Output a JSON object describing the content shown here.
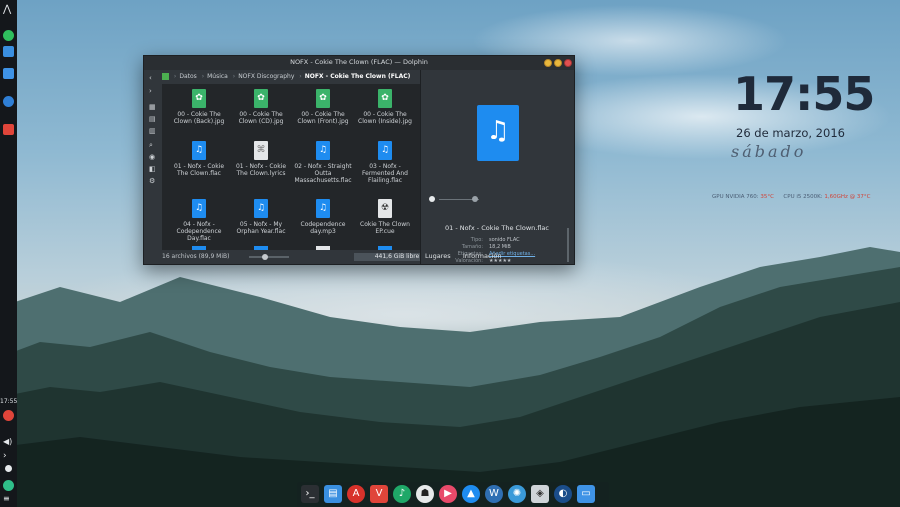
{
  "window": {
    "title": "NOFX - Cokie The Clown (FLAC) — Dolphin",
    "minimize_icon": "minimize-icon",
    "maximize_icon": "maximize-icon",
    "close_icon": "close-icon"
  },
  "breadcrumb": [
    "Datos",
    "Música",
    "NOFX Discography",
    "NOFX - Cokie The Clown (FLAC)"
  ],
  "files": [
    {
      "name": "00 - Cokie The Clown (Back).jpg",
      "type": "image"
    },
    {
      "name": "00 - Cokie The Clown (CD).jpg",
      "type": "image"
    },
    {
      "name": "00 - Cokie The Clown (Front).jpg",
      "type": "image"
    },
    {
      "name": "00 - Cokie The Clown (Inside).jpg",
      "type": "image"
    },
    {
      "name": "01 - Nofx - Cokie The Clown.flac",
      "type": "audio"
    },
    {
      "name": "01 - Nofx - Cokie The Clown.lyrics",
      "type": "text"
    },
    {
      "name": "02 - Nofx - Straight Outta Massachusetts.flac",
      "type": "audio"
    },
    {
      "name": "03 - Nofx - Fermented And Flailing.flac",
      "type": "audio"
    },
    {
      "name": "04 - Nofx - Codependence Day.flac",
      "type": "audio"
    },
    {
      "name": "05 - Nofx - My Orphan Year.flac",
      "type": "audio"
    },
    {
      "name": "Codependence day.mp3",
      "type": "audio"
    },
    {
      "name": "Cokie The Clown EP.cue",
      "type": "cue"
    }
  ],
  "status": {
    "count": "16 archivos (89,9 MiB)",
    "free": "441,6 GiB libre"
  },
  "info_panel": {
    "title": "01 - Nofx - Cokie The Clown.flac",
    "rows": [
      {
        "key": "Tipo:",
        "value": "sonido FLAC"
      },
      {
        "key": "Tamaño:",
        "value": "18,2 MiB"
      },
      {
        "key": "Etiquetas:",
        "value": "Añadir etiquetas..."
      },
      {
        "key": "Valoración:",
        "value": "★★★★★"
      }
    ],
    "tabs": [
      "Lugares",
      "Información"
    ]
  },
  "widget": {
    "time": "17:55",
    "date": "26 de marzo, 2016",
    "day": "sábado",
    "sysmon": {
      "gpu_label": "GPU NVIDIA 760:",
      "gpu_temp": "35°C",
      "cpu_label": "CPU i5 2500K:",
      "cpu_freq": "1,60GHz @ 37°C"
    }
  },
  "panel": {
    "clock": "17:55",
    "icons": [
      "app-launcher-icon",
      "spotify-icon",
      "files-icon",
      "folder-icon",
      "browser-icon",
      "vivaldi-icon"
    ]
  },
  "dock": {
    "icons": [
      "terminal-icon",
      "files-icon",
      "pdf-reader-icon",
      "vivaldi-icon",
      "music-player-icon",
      "inkscape-icon",
      "media-player-icon",
      "kde-icon",
      "wordpress-icon",
      "sketch-icon",
      "package-icon",
      "steam-icon",
      "folder-icon"
    ]
  },
  "colors": {
    "accent_blue": "#1e8cf0",
    "window_bg": "#31363b",
    "clock_color": "#1f2a3a",
    "hot_red": "#d0453a"
  }
}
